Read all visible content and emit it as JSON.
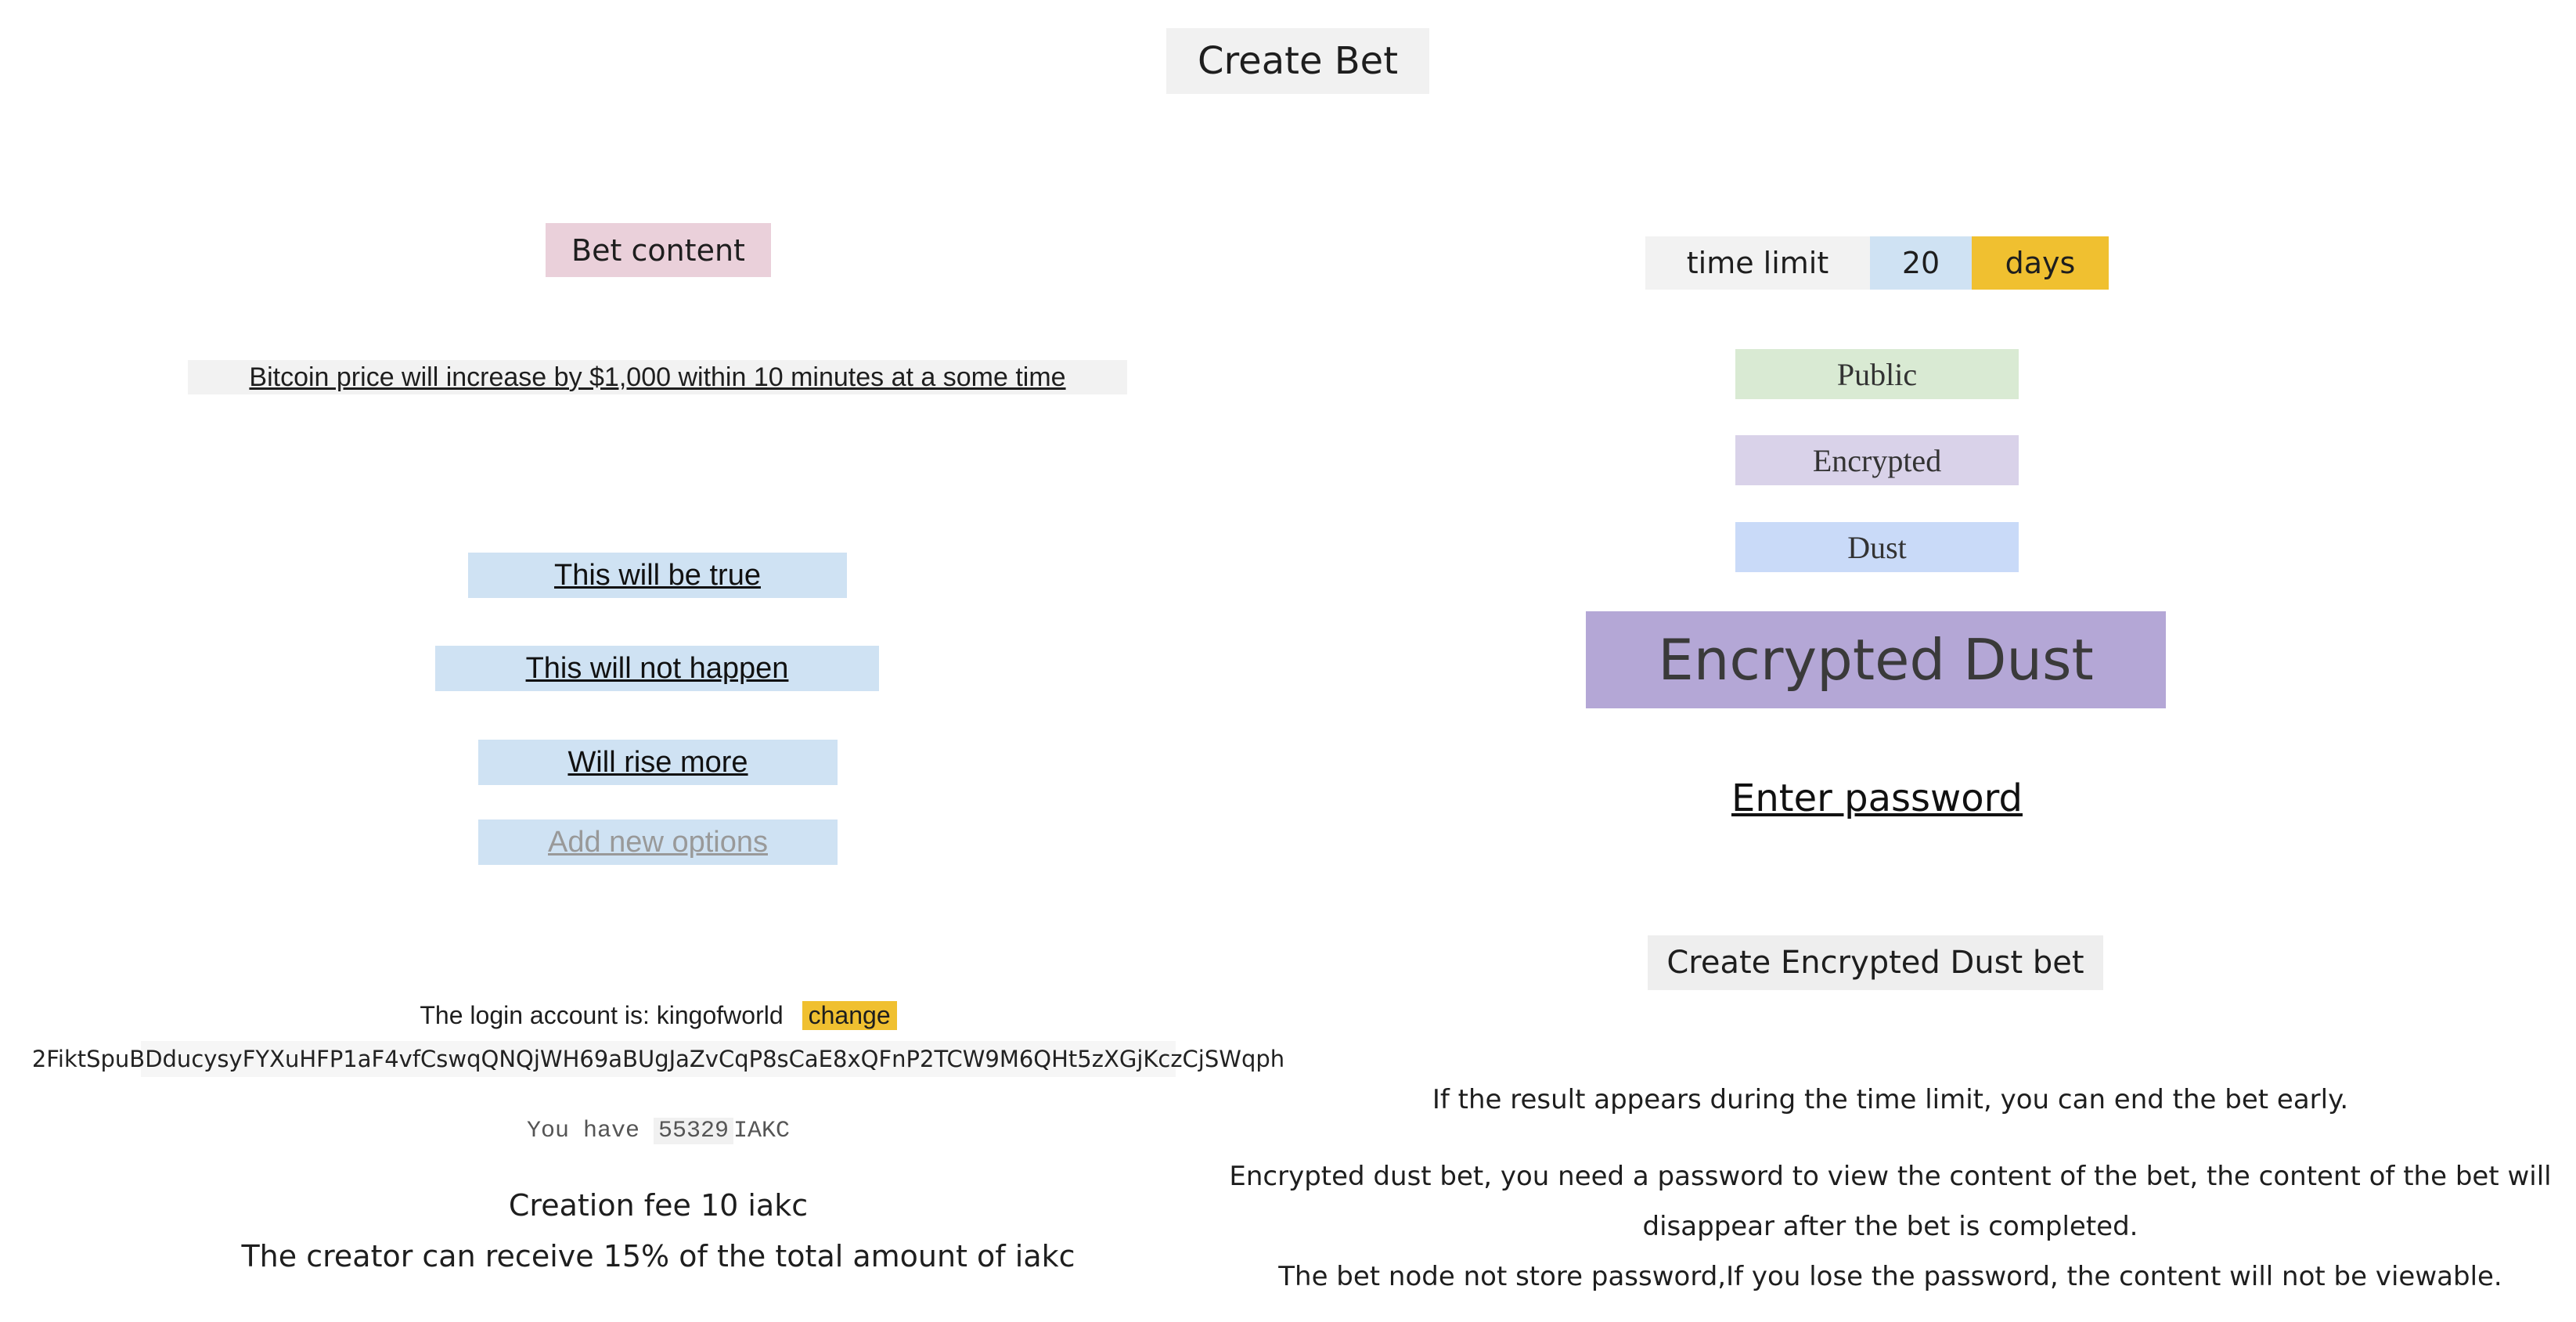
{
  "header": {
    "title": "Create Bet"
  },
  "bet": {
    "content_label": "Bet content",
    "text": "Bitcoin price will increase by $1,000   within 10 minutes at a some time",
    "options": [
      "This will be true",
      "This will not happen",
      "Will rise more"
    ],
    "add_option_placeholder": "Add new options"
  },
  "account": {
    "login_text": "The login account is: kingofworld",
    "change_label": "change",
    "address": "2FiktSpuBDducysyFYXuHFP1aF4vfCswqQNQjWH69aBUgJaZvCqP8sCaE8xQFnP2TCW9M6QHt5zXGjKczCjSWqph",
    "balance_prefix": "You have",
    "balance_value": "55329",
    "balance_unit": "IAKC"
  },
  "fees": {
    "creation_fee": "Creation fee 10 iakc",
    "creator_reward": "The creator can receive 15% of the total amount of iakc"
  },
  "settings": {
    "time_limit_label": "time limit",
    "time_limit_value": "20",
    "time_limit_unit": "days",
    "types": [
      "Public",
      "Encrypted",
      "Dust"
    ],
    "selected_type": "Encrypted Dust",
    "password_placeholder": "Enter password",
    "create_button": "Create Encrypted Dust bet"
  },
  "notes": {
    "line1": "If the result appears during the time limit, you can end the bet early.",
    "line2": "Encrypted dust bet, you need a password to view the content of the bet, the content of the bet will",
    "line3": "disappear after the bet is completed.",
    "line4": "The bet node not store password,If you lose the password, the content will not be viewable."
  },
  "colors": {
    "bet_label_bg": "#ead0da",
    "option_bg": "#cfe2f3",
    "accent_yellow": "#f0c030",
    "public_bg": "#d9ead3",
    "encrypted_bg": "#d9d2e9",
    "dust_bg": "#c9daf8",
    "selected_bg": "#b4a7d6"
  }
}
